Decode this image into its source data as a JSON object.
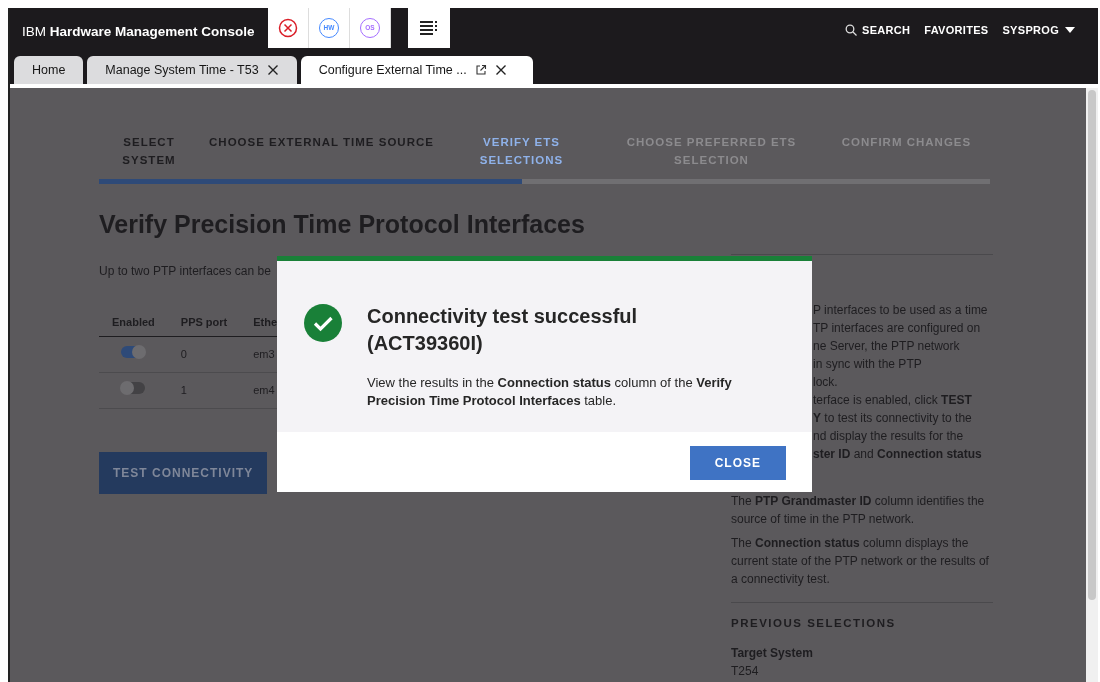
{
  "header": {
    "brand_prefix": "IBM",
    "brand": "Hardware Management Console",
    "status_icons": [
      {
        "kind": "error"
      },
      {
        "kind": "hw",
        "label": "HW"
      },
      {
        "kind": "os",
        "label": "OS"
      }
    ],
    "actions": [
      {
        "kind": "search",
        "label": "SEARCH"
      },
      {
        "kind": "plain",
        "label": "FAVORITES"
      },
      {
        "kind": "user",
        "label": "SYSPROG"
      }
    ]
  },
  "tabs": [
    {
      "label": "Home",
      "selected": false,
      "closable": false,
      "popout": false
    },
    {
      "label": "Manage System Time - T53",
      "selected": false,
      "closable": true,
      "popout": false
    },
    {
      "label": "Configure External Time ...",
      "selected": true,
      "closable": true,
      "popout": true
    }
  ],
  "stepper": {
    "level": 0.475,
    "steps": [
      {
        "label": "SELECT SYSTEM",
        "completed": true,
        "selected": false
      },
      {
        "label": "CHOOSE EXTERNAL TIME SOURCE",
        "completed": true,
        "selected": false
      },
      {
        "label": "VERIFY ETS SELECTIONS",
        "completed": false,
        "selected": true
      },
      {
        "label": "CHOOSE PREFERRED ETS SELECTION",
        "completed": false,
        "selected": false
      },
      {
        "label": "CONFIRM CHANGES",
        "completed": false,
        "selected": false
      }
    ]
  },
  "page_title": "Verify Precision Time Protocol Interfaces",
  "intro": "Up to two PTP interfaces can be",
  "table": {
    "columns": [
      "Enabled",
      "PPS port",
      "Ethe"
    ],
    "rows": [
      {
        "enabled": true,
        "pps_port": "0",
        "column_3": "em3"
      },
      {
        "enabled": false,
        "pps_port": "1",
        "column_3": "em4"
      }
    ]
  },
  "test_button": "TEST CONNECTIVITY",
  "help": {
    "cut_lines": [
      "P interfaces to be used as a time",
      "TP interfaces are configured on",
      "ne Server, the PTP network",
      "in sync with the PTP",
      "lock.",
      "terface is enabled, click **TEST**",
      "**Y** to test its connectivity to the",
      "nd display the results for the",
      "**ster ID** and **Connection status**"
    ],
    "paragraphs": [
      "The **PTP Grandmaster ID** column identifies the source of time in the PTP network.",
      "The **Connection status** column displays the current state of the PTP network or the results of a connectivity test."
    ],
    "section_title": "PREVIOUS SELECTIONS",
    "field_label": "Target System",
    "field_value": "T254"
  },
  "dialog": {
    "kind": "success",
    "title": "Connectivity test successful (ACT39360I)",
    "body": "View the results in the **Connection status** column of the **Verify Precision Time Protocol Interfaces** table.",
    "button": "CLOSE"
  }
}
